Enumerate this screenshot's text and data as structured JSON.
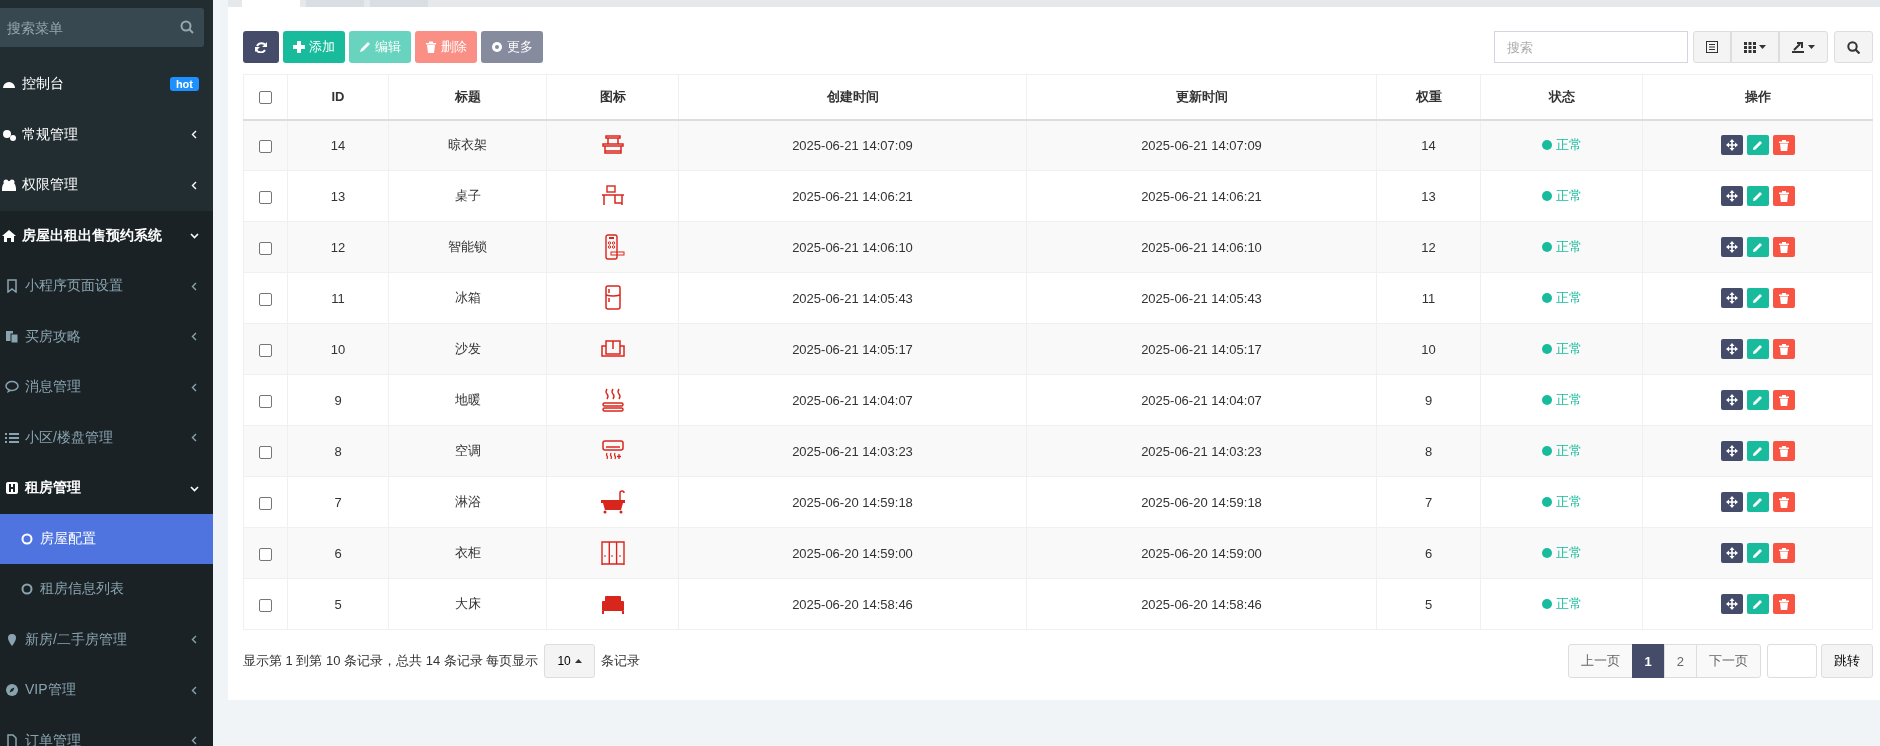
{
  "tabs": [
    {
      "selected": true
    },
    {
      "selected": false
    },
    {
      "selected": false
    }
  ],
  "sidebar": {
    "search": {
      "placeholder": "搜索菜单"
    },
    "items": [
      {
        "kind": "dashboard",
        "label": "控制台",
        "badge": "hot",
        "selected": false
      },
      {
        "kind": "gears",
        "label": "常规管理",
        "expanded": false,
        "selected": false
      },
      {
        "kind": "users",
        "label": "权限管理",
        "expanded": false,
        "selected": false
      },
      {
        "kind": "home",
        "label": "房屋出租出售预约系统",
        "expanded": true,
        "selected": false,
        "children": [
          {
            "kind": "bookmark",
            "label": "小程序页面设置",
            "expanded": false,
            "selected": false
          },
          {
            "kind": "copy",
            "label": "买房攻略",
            "expanded": false,
            "selected": false
          },
          {
            "kind": "comment",
            "label": "消息管理",
            "expanded": false,
            "selected": false
          },
          {
            "kind": "list",
            "label": "小区/楼盘管理",
            "expanded": false,
            "selected": false
          },
          {
            "kind": "hotel",
            "label": "租房管理",
            "expanded": true,
            "selected": false,
            "children": [
              {
                "kind": "circle",
                "label": "房屋配置",
                "selected": true
              },
              {
                "kind": "circle",
                "label": "租房信息列表",
                "selected": false
              }
            ]
          },
          {
            "kind": "marker",
            "label": "新房/二手房管理",
            "expanded": false,
            "selected": false
          },
          {
            "kind": "compass",
            "label": "VIP管理",
            "expanded": false,
            "selected": false
          },
          {
            "kind": "file",
            "label": "订单管理",
            "expanded": false,
            "selected": false
          }
        ]
      }
    ]
  },
  "toolbar": {
    "buttons": [
      {
        "kind": "refresh",
        "disabled": false
      },
      {
        "kind": "add",
        "label": "添加",
        "disabled": false
      },
      {
        "kind": "edit",
        "label": "编辑",
        "disabled": true
      },
      {
        "kind": "delete",
        "label": "删除",
        "disabled": true
      },
      {
        "kind": "more",
        "label": "更多",
        "disabled": false
      }
    ],
    "search": {
      "placeholder": "搜索"
    }
  },
  "table": {
    "header_checkbox": {
      "checked": false
    },
    "columns": [
      "ID",
      "标题",
      "图标",
      "创建时间",
      "更新时间",
      "权重",
      "状态",
      "操作"
    ],
    "rows": [
      {
        "checked": false,
        "id": "14",
        "title": "晾衣架",
        "kind": "rack",
        "created": "2025-06-21 14:07:09",
        "updated": "2025-06-21 14:07:09",
        "weight": "14",
        "status": "正常"
      },
      {
        "checked": false,
        "id": "13",
        "title": "桌子",
        "kind": "desk",
        "created": "2025-06-21 14:06:21",
        "updated": "2025-06-21 14:06:21",
        "weight": "13",
        "status": "正常"
      },
      {
        "checked": false,
        "id": "12",
        "title": "智能锁",
        "kind": "lock",
        "created": "2025-06-21 14:06:10",
        "updated": "2025-06-21 14:06:10",
        "weight": "12",
        "status": "正常"
      },
      {
        "checked": false,
        "id": "11",
        "title": "冰箱",
        "kind": "fridge",
        "created": "2025-06-21 14:05:43",
        "updated": "2025-06-21 14:05:43",
        "weight": "11",
        "status": "正常"
      },
      {
        "checked": false,
        "id": "10",
        "title": "沙发",
        "kind": "sofa",
        "created": "2025-06-21 14:05:17",
        "updated": "2025-06-21 14:05:17",
        "weight": "10",
        "status": "正常"
      },
      {
        "checked": false,
        "id": "9",
        "title": "地暖",
        "kind": "heater",
        "created": "2025-06-21 14:04:07",
        "updated": "2025-06-21 14:04:07",
        "weight": "9",
        "status": "正常"
      },
      {
        "checked": false,
        "id": "8",
        "title": "空调",
        "kind": "aircon",
        "created": "2025-06-21 14:03:23",
        "updated": "2025-06-21 14:03:23",
        "weight": "8",
        "status": "正常"
      },
      {
        "checked": false,
        "id": "7",
        "title": "淋浴",
        "kind": "bathtub",
        "created": "2025-06-20 14:59:18",
        "updated": "2025-06-20 14:59:18",
        "weight": "7",
        "status": "正常"
      },
      {
        "checked": false,
        "id": "6",
        "title": "衣柜",
        "kind": "wardrobe",
        "created": "2025-06-20 14:59:00",
        "updated": "2025-06-20 14:59:00",
        "weight": "6",
        "status": "正常"
      },
      {
        "checked": false,
        "id": "5",
        "title": "大床",
        "kind": "bed",
        "created": "2025-06-20 14:58:46",
        "updated": "2025-06-20 14:58:46",
        "weight": "5",
        "status": "正常"
      }
    ]
  },
  "pagination": {
    "summary_before": "显示第 1 到第 10 条记录，总共 14 条记录 每页显示",
    "page_size": "10",
    "summary_after": "条记录",
    "pages": [
      {
        "label": "上一页",
        "selected": false
      },
      {
        "label": "1",
        "selected": true
      },
      {
        "label": "2",
        "selected": false
      },
      {
        "label": "下一页",
        "selected": false
      }
    ],
    "jump": "跳转"
  }
}
